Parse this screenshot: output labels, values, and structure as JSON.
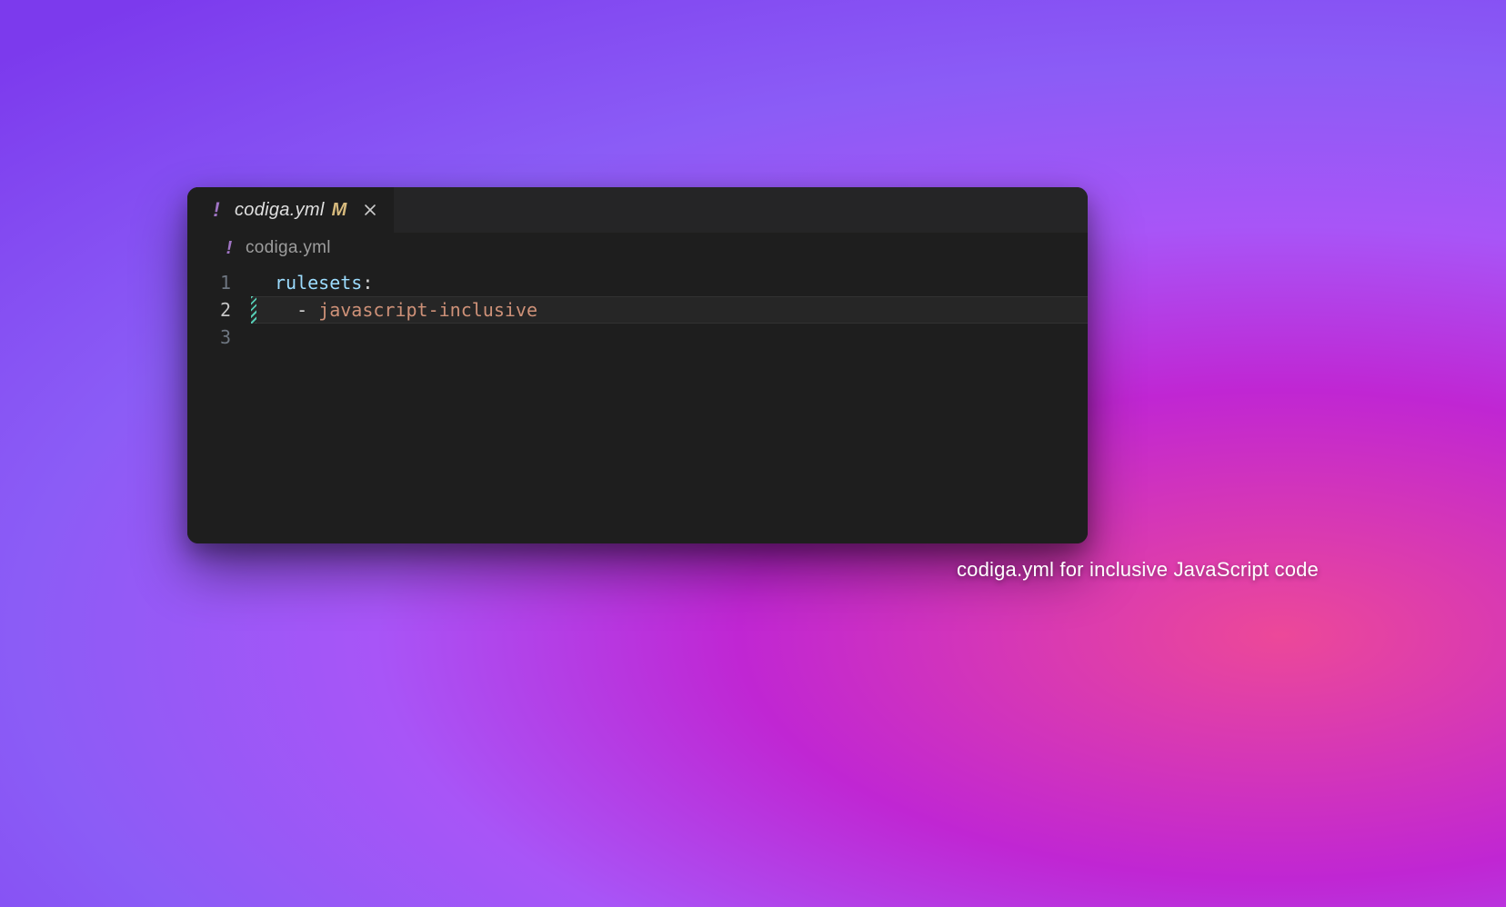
{
  "tab": {
    "filename": "codiga.yml",
    "modified_indicator": "M",
    "file_icon": "!"
  },
  "breadcrumb": {
    "filename": "codiga.yml",
    "file_icon": "!"
  },
  "gutter": {
    "lines": [
      "1",
      "2",
      "3"
    ],
    "active_index": 1
  },
  "code": {
    "line1": {
      "key": "rulesets",
      "colon": ":"
    },
    "line2": {
      "indent": "  ",
      "dash": "- ",
      "value": "javascript-inclusive"
    }
  },
  "caption": "codiga.yml for inclusive JavaScript code"
}
